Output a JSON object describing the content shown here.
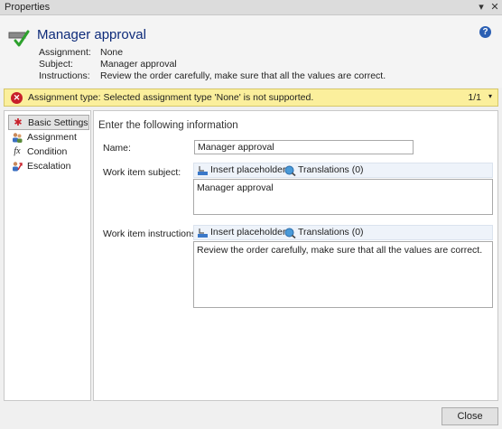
{
  "window": {
    "title": "Properties",
    "dropdown_glyph": "▾",
    "close_glyph": "✕"
  },
  "header": {
    "title": "Manager approval",
    "icon": "task-check-icon",
    "help_glyph": "?",
    "assignment_label": "Assignment:",
    "assignment_value": "None",
    "subject_label": "Subject:",
    "subject_value": "Manager approval",
    "instructions_label": "Instructions:",
    "instructions_value": "Review the order carefully, make sure that all the values are correct."
  },
  "warning": {
    "glyph": "✕",
    "text": "Assignment type: Selected assignment type 'None' is not supported.",
    "count": "1/1",
    "dropdown_glyph": "▾",
    "color": "#fbef9c"
  },
  "nav": {
    "items": [
      {
        "label": "Basic Settings",
        "icon": "asterisk-icon",
        "glyph": "✱",
        "active": true
      },
      {
        "label": "Assignment",
        "icon": "users-icon",
        "glyph": "👥",
        "active": false
      },
      {
        "label": "Condition",
        "icon": "function-icon",
        "glyph": "fx",
        "active": false
      },
      {
        "label": "Escalation",
        "icon": "escalation-icon",
        "glyph": "⬈",
        "active": false
      }
    ]
  },
  "main": {
    "section_title": "Enter the following information",
    "name_label": "Name:",
    "name_value": "Manager approval",
    "subject_label": "Work item subject:",
    "subject_value": "Manager approval",
    "instructions_label": "Work item instructions:",
    "instructions_value": "Review the order carefully, make sure that all the values are correct.",
    "insert_placeholder_label": "Insert placeholder",
    "translations_label": "Translations (0)"
  },
  "footer": {
    "close_label": "Close"
  }
}
